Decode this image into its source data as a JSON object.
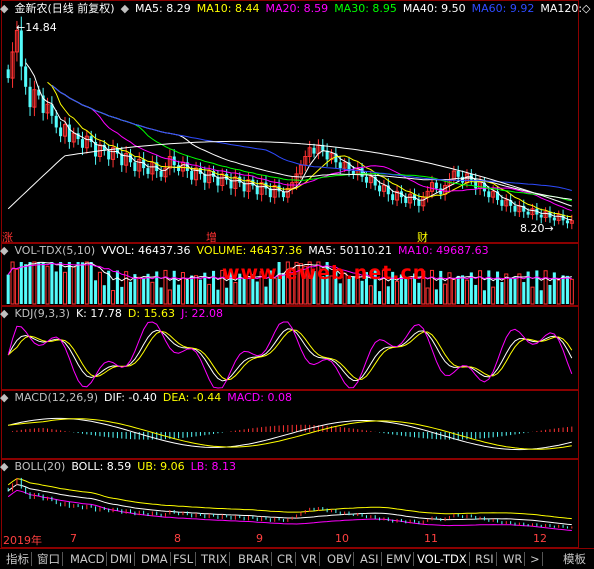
{
  "main_header": {
    "title": "金新农(日线 前复权)",
    "items": [
      {
        "label": "MA5: 8.29",
        "color": "#ffffff"
      },
      {
        "label": "MA10: 8.44",
        "color": "#ffff00"
      },
      {
        "label": "MA20: 8.59",
        "color": "#ff00ff"
      },
      {
        "label": "MA30: 8.95",
        "color": "#00ff00"
      },
      {
        "label": "MA40: 9.50",
        "color": "#ffffff"
      },
      {
        "label": "MA60: 9.92",
        "color": "#2e4bff"
      },
      {
        "label": "MA120:◇",
        "color": "#ffffff"
      }
    ]
  },
  "price_labels": {
    "high": "14.84",
    "low": "8.20"
  },
  "markers": {
    "zhang": "涨",
    "zeng": "增",
    "cai": "财"
  },
  "vol_header": {
    "name": "VOL-TDX(5,10)",
    "items": [
      {
        "label": "VVOL: 46437.36",
        "color": "#ffffff"
      },
      {
        "label": "VOLUME: 46437.36",
        "color": "#ffff00"
      },
      {
        "label": "MA5: 50110.21",
        "color": "#ffffff"
      },
      {
        "label": "MA10: 49687.63",
        "color": "#ff00ff"
      }
    ]
  },
  "kdj_header": {
    "name": "KDJ(9,3,3)",
    "items": [
      {
        "label": "K: 17.78",
        "color": "#ffffff"
      },
      {
        "label": "D: 15.63",
        "color": "#ffff00"
      },
      {
        "label": "J: 22.08",
        "color": "#ff00ff"
      }
    ]
  },
  "macd_header": {
    "name": "MACD(12,26,9)",
    "items": [
      {
        "label": "DIF: -0.40",
        "color": "#ffffff"
      },
      {
        "label": "DEA: -0.44",
        "color": "#ffff00"
      },
      {
        "label": "MACD: 0.08",
        "color": "#ff00ff"
      }
    ]
  },
  "boll_header": {
    "name": "BOLL(20)",
    "items": [
      {
        "label": "BOLL: 8.59",
        "color": "#ffffff"
      },
      {
        "label": "UB: 9.06",
        "color": "#ffff00"
      },
      {
        "label": "LB: 8.13",
        "color": "#ff00ff"
      }
    ]
  },
  "watermark": "www.eweb.net.cn",
  "date_labels": [
    "2019年",
    "7",
    "8",
    "9",
    "10",
    "11",
    "12"
  ],
  "tabs": [
    "指标",
    "窗口",
    "MACD",
    "DMI",
    "DMA",
    "FSL",
    "TRIX",
    "BRAR",
    "CR",
    "VR",
    "OBV",
    "ASI",
    "EMV",
    "VOL-TDX",
    "RSI",
    "WR",
    ">",
    "模板"
  ],
  "colors": {
    "up": "#ff3232",
    "down": "#54fcfc",
    "border": "#8b0000"
  },
  "chart_data": {
    "type": "candlestick",
    "title": "金新农(日线 前复权)",
    "y_range_price": [
      7.9,
      15.2
    ],
    "annotated_high": 14.84,
    "annotated_low": 8.2,
    "close_approx": [
      13.2,
      14.1,
      14.84,
      13.6,
      12.9,
      12.2,
      12.8,
      12.6,
      12.0,
      12.3,
      11.9,
      11.5,
      11.2,
      11.6,
      11.0,
      11.3,
      11.1,
      10.8,
      11.2,
      11.0,
      10.5,
      10.9,
      10.7,
      10.4,
      10.8,
      10.6,
      10.2,
      10.6,
      10.3,
      10.0,
      10.4,
      10.1,
      9.9,
      10.3,
      10.0,
      9.8,
      10.1,
      10.5,
      10.2,
      10.0,
      10.3,
      10.0,
      9.7,
      10.1,
      9.9,
      9.6,
      10.0,
      9.8,
      9.5,
      9.9,
      9.7,
      9.4,
      9.8,
      9.6,
      9.3,
      9.7,
      9.5,
      9.2,
      9.6,
      9.4,
      9.1,
      9.5,
      9.3,
      9.1,
      9.4,
      9.6,
      9.9,
      10.2,
      10.5,
      10.8,
      10.6,
      10.9,
      10.7,
      10.4,
      10.6,
      10.3,
      10.1,
      10.3,
      10.0,
      9.9,
      10.1,
      9.8,
      9.6,
      9.8,
      9.5,
      9.3,
      9.5,
      9.2,
      9.0,
      9.3,
      9.1,
      8.9,
      9.2,
      9.0,
      8.8,
      9.1,
      9.3,
      9.6,
      9.4,
      9.2,
      9.5,
      9.7,
      10.0,
      9.8,
      9.6,
      9.9,
      9.7,
      9.4,
      9.6,
      9.3,
      9.1,
      9.3,
      9.0,
      8.8,
      9.0,
      8.8,
      8.6,
      8.8,
      8.6,
      8.5,
      8.7,
      8.5,
      8.4,
      8.6,
      8.4,
      8.3,
      8.5,
      8.3,
      8.2,
      8.29
    ]
  }
}
